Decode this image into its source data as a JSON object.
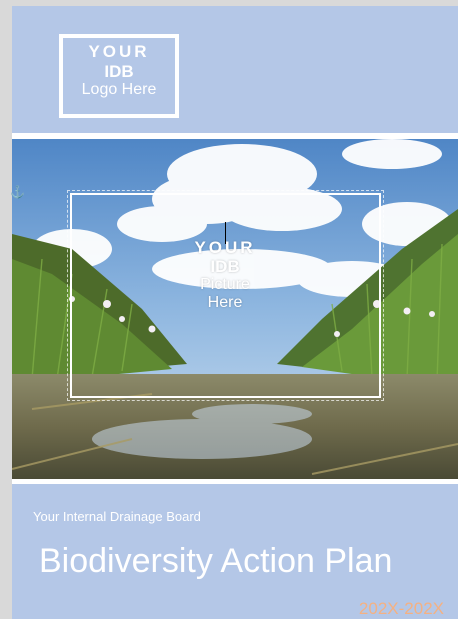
{
  "logo": {
    "line1": "YOUR",
    "line2": "IDB",
    "line3": "Logo Here"
  },
  "picture_placeholder": {
    "line1": "YOUR",
    "line2": "IDB",
    "line3": "Picture",
    "line4": "Here"
  },
  "icons": {
    "anchor": "anchor-icon"
  },
  "footer": {
    "board_name": "Your Internal Drainage Board",
    "title": "Biodiversity Action Plan",
    "years": "202X-202X"
  },
  "colors": {
    "cover_background": "#b4c7e7",
    "text": "#ffffff",
    "years_accent": "#f4b183",
    "anchor": "#2e75b6"
  }
}
